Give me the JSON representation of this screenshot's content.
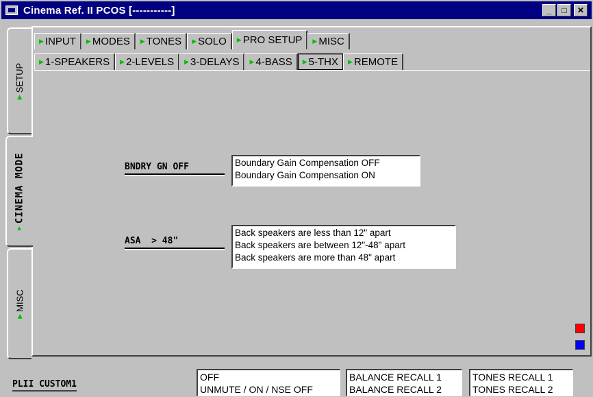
{
  "window": {
    "title": "Cinema Ref. II PCOS [-----------]",
    "minimize": "_",
    "maximize": "□",
    "close": "✕"
  },
  "side_tabs": [
    {
      "label": "SETUP",
      "active": false
    },
    {
      "label": "CINEMA MODE",
      "active": true
    },
    {
      "label": "MISC",
      "active": false
    }
  ],
  "top_tabs": [
    {
      "label": "INPUT"
    },
    {
      "label": "MODES"
    },
    {
      "label": "TONES"
    },
    {
      "label": "SOLO"
    },
    {
      "label": "PRO SETUP",
      "selected": true
    },
    {
      "label": "MISC"
    }
  ],
  "sub_tabs": [
    {
      "label": "1-SPEAKERS"
    },
    {
      "label": "2-LEVELS"
    },
    {
      "label": "3-DELAYS"
    },
    {
      "label": "4-BASS"
    },
    {
      "label": "5-THX",
      "pressed": true
    },
    {
      "label": "REMOTE"
    }
  ],
  "settings": {
    "bndry": {
      "label": "BNDRY GN OFF",
      "options": [
        "Boundary Gain Compensation OFF",
        "Boundary Gain Compensation ON"
      ]
    },
    "asa": {
      "label": "ASA  > 48\"",
      "options": [
        "Back speakers are less than 12\" apart",
        "Back speakers are between 12\"-48\" apart",
        "Back speakers are more than 48\" apart"
      ]
    }
  },
  "colors": {
    "red_button": "#ff0000",
    "blue_button": "#0000ff",
    "title_bar": "#000080"
  },
  "status": {
    "label": "PLII CUSTOM1",
    "box1": [
      "OFF",
      "UNMUTE / ON / NSE OFF"
    ],
    "box2": [
      "BALANCE RECALL 1",
      "BALANCE RECALL 2"
    ],
    "box3": [
      "TONES RECALL 1",
      "TONES RECALL 2"
    ]
  }
}
